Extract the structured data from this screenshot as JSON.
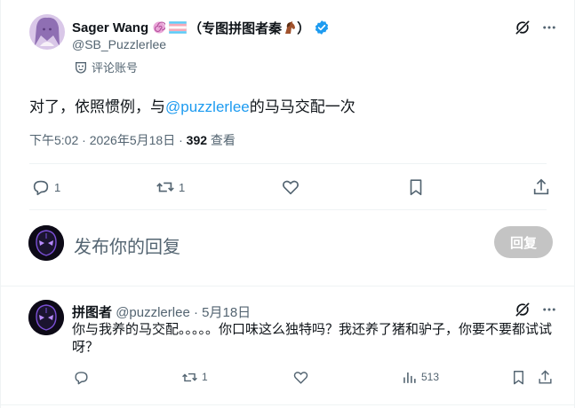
{
  "tweet": {
    "author_name": "Sager Wang",
    "author_suffix": "（专图拼图者秦",
    "author_suffix_end": "）",
    "handle": "@SB_Puzzlerlee",
    "account_type": "评论账号",
    "text_before": "对了，依照惯例，与",
    "mention": "@puzzlerlee",
    "text_after": "的马马交配一次",
    "time": "下午5:02",
    "date": "2026年5月18日",
    "dot": "·",
    "views_count": "392",
    "views_label": "查看",
    "reply_count": "1",
    "retweet_count": "1"
  },
  "composer": {
    "placeholder": "发布你的回复",
    "reply_button": "回复"
  },
  "reply": {
    "author_name": "拼图者",
    "handle": "@puzzlerlee",
    "dot": "·",
    "date": "5月18日",
    "text": "你与我养的马交配。。。。。你口味这么独特吗？我还养了猪和驴子，你要不要都试试呀？",
    "retweet_count": "1",
    "views_count": "513"
  },
  "colors": {
    "accent": "#1d9bf0",
    "text": "#0f1419",
    "muted": "#536471",
    "divider": "#eff3f4",
    "reply_button_disabled": "#c4c4c4"
  },
  "icons": [
    "grok-icon",
    "more-icon",
    "verified-badge-icon",
    "comment-icon",
    "retweet-icon",
    "like-icon",
    "bookmark-icon",
    "share-icon",
    "views-icon",
    "mask-icon"
  ]
}
